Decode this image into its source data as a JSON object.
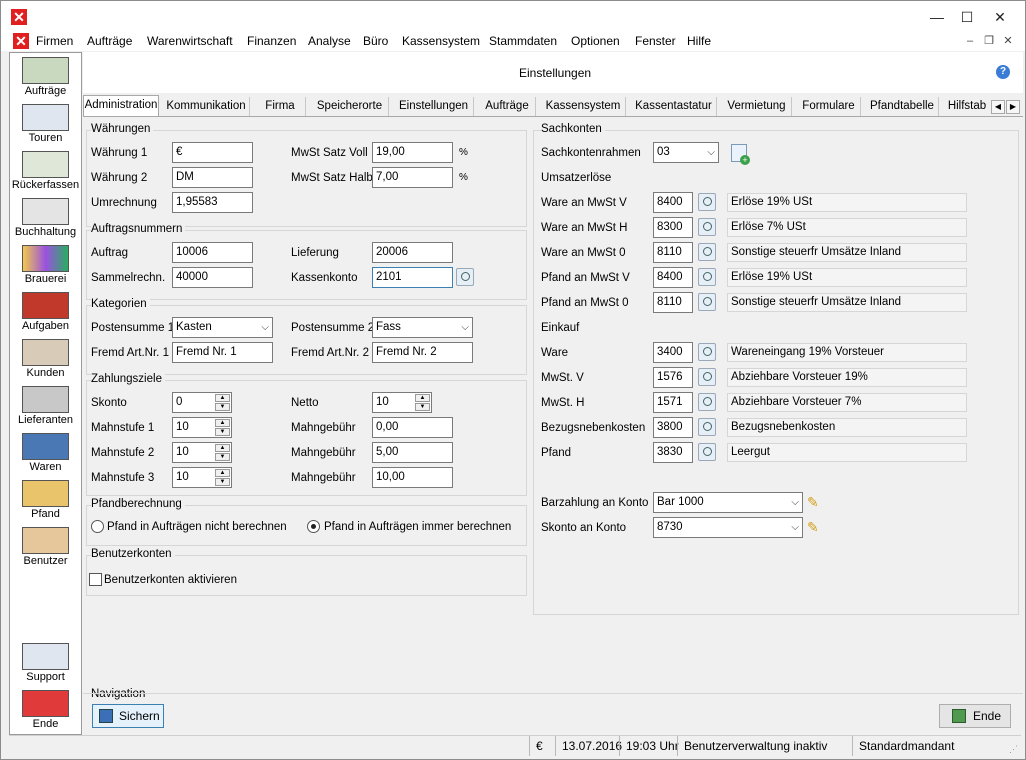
{
  "menu": [
    "Firmen",
    "Aufträge",
    "Warenwirtschaft",
    "Finanzen",
    "Analyse",
    "Büro",
    "Kassensystem",
    "Stammdaten",
    "Optionen",
    "Fenster",
    "Hilfe"
  ],
  "window_controls": {
    "minimize": "—",
    "maximize": "☐",
    "close": "✕"
  },
  "sidebar": [
    {
      "label": "Aufträge",
      "icon": "headset-agent-icon"
    },
    {
      "label": "Touren",
      "icon": "truck-icon"
    },
    {
      "label": "Rückerfassen",
      "icon": "truck-return-icon"
    },
    {
      "label": "Buchhaltung",
      "icon": "calculator-icon"
    },
    {
      "label": "Brauerei",
      "icon": "brewery-icon"
    },
    {
      "label": "Aufgaben",
      "icon": "tasks-icon"
    },
    {
      "label": "Kunden",
      "icon": "customers-icon"
    },
    {
      "label": "Lieferanten",
      "icon": "suppliers-icon"
    },
    {
      "label": "Waren",
      "icon": "goods-icon"
    },
    {
      "label": "Pfand",
      "icon": "crates-icon"
    },
    {
      "label": "Benutzer",
      "icon": "user-lock-icon"
    }
  ],
  "sidebar_bottom": [
    {
      "label": "Support",
      "icon": "handshake-icon"
    },
    {
      "label": "Ende",
      "icon": "power-icon"
    }
  ],
  "header": {
    "title": "Einstellungen"
  },
  "tabs": [
    "Administration",
    "Kommunikation",
    "Firma",
    "Speicherorte",
    "Einstellungen",
    "Aufträge",
    "Kassensystem",
    "Kassentastatur",
    "Vermietung",
    "Formulare",
    "Pfandtabelle",
    "Hilfstab"
  ],
  "waehrungen": {
    "title": "Währungen",
    "w1_label": "Währung 1",
    "w1": "€",
    "w2_label": "Währung 2",
    "w2": "DM",
    "um_label": "Umrechnung",
    "um": "1,95583",
    "voll_label": "MwSt Satz Voll",
    "voll": "19,00",
    "voll_unit": "%",
    "halb_label": "MwSt Satz Halb",
    "halb": "7,00",
    "halb_unit": "%"
  },
  "auftragsnummern": {
    "title": "Auftragsnummern",
    "auftrag_label": "Auftrag",
    "auftrag": "10006",
    "sammel_label": "Sammelrechn.",
    "sammel": "40000",
    "lieferung_label": "Lieferung",
    "lieferung": "20006",
    "kasse_label": "Kassenkonto",
    "kasse": "2101"
  },
  "kategorien": {
    "title": "Kategorien",
    "ps1_label": "Postensumme 1",
    "ps1": "Kasten",
    "ps2_label": "Postensumme 2",
    "ps2": "Fass",
    "f1_label": "Fremd Art.Nr. 1",
    "f1": "Fremd Nr. 1",
    "f2_label": "Fremd Art.Nr. 2",
    "f2": "Fremd Nr. 2"
  },
  "zahlungsziele": {
    "title": "Zahlungsziele",
    "skonto_label": "Skonto",
    "skonto": "0",
    "netto_label": "Netto",
    "netto": "10",
    "m1_label": "Mahnstufe 1",
    "m1": "10",
    "m2_label": "Mahnstufe 2",
    "m2": "10",
    "m3_label": "Mahnstufe 3",
    "m3": "10",
    "g_label": "Mahngebühr",
    "g1": "0,00",
    "g2": "5,00",
    "g3": "10,00"
  },
  "pfand": {
    "title": "Pfandberechnung",
    "opt1": "Pfand in Aufträgen nicht berechnen",
    "opt2": "Pfand in Aufträgen immer berechnen"
  },
  "benutzer": {
    "title": "Benutzerkonten",
    "check_label": "Benutzerkonten aktivieren"
  },
  "sachkonten": {
    "title": "Sachkonten",
    "rahmen_label": "Sachkontenrahmen",
    "rahmen": "03",
    "umsatz_title": "Umsatzerlöse",
    "umsatz": [
      {
        "label": "Ware an MwSt V",
        "konto": "8400",
        "name": "Erlöse 19% USt"
      },
      {
        "label": "Ware an MwSt H",
        "konto": "8300",
        "name": "Erlöse 7% USt"
      },
      {
        "label": "Ware an MwSt 0",
        "konto": "8110",
        "name": "Sonstige steuerfr Umsätze Inland"
      },
      {
        "label": "Pfand an MwSt V",
        "konto": "8400",
        "name": "Erlöse 19% USt"
      },
      {
        "label": "Pfand an MwSt 0",
        "konto": "8110",
        "name": "Sonstige steuerfr Umsätze Inland"
      }
    ],
    "einkauf_title": "Einkauf",
    "einkauf": [
      {
        "label": "Ware",
        "konto": "3400",
        "name": "Wareneingang 19% Vorsteuer"
      },
      {
        "label": "MwSt. V",
        "konto": "1576",
        "name": "Abziehbare Vorsteuer 19%"
      },
      {
        "label": "MwSt. H",
        "konto": "1571",
        "name": "Abziehbare Vorsteuer 7%"
      },
      {
        "label": "Bezugsnebenkosten",
        "konto": "3800",
        "name": "Bezugsnebenkosten"
      },
      {
        "label": "Pfand",
        "konto": "3830",
        "name": "Leergut"
      }
    ],
    "bar_label": "Barzahlung an Konto",
    "bar": "Bar 1000",
    "skonto_label": "Skonto an Konto",
    "skonto": "8730"
  },
  "navigation": {
    "title": "Navigation",
    "save": "Sichern",
    "end": "Ende"
  },
  "status": {
    "currency": "€",
    "date": "13.07.2016",
    "time": "19:03 Uhr",
    "user_mgmt": "Benutzerverwaltung inaktiv",
    "tenant": "Standardmandant"
  }
}
